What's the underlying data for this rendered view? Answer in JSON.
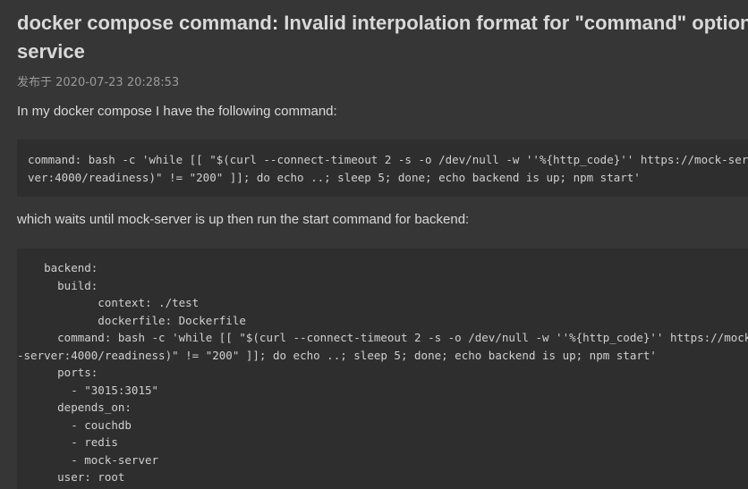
{
  "article": {
    "title": "docker compose command: Invalid interpolation format for \"command\" option in service",
    "published_label": "发布于 2020-07-23 20:28:53",
    "intro": "In my docker compose I have the following command:",
    "middle": "which waits until mock-server is up then run the start command for backend:"
  },
  "code_1": {
    "lines": [
      "command: bash -c 'while [[ \"$(curl --connect-timeout 2 -s -o /dev/null -w ''%{http_code}'' https://mock-ser",
      "ver:4000/readiness)\" != \"200\" ]]; do echo ..; sleep 5; done; echo backend is up; npm start'"
    ]
  },
  "code_2": {
    "lines": [
      "    backend:",
      "      build:",
      "            context: ./test",
      "            dockerfile: Dockerfile",
      "      command: bash -c 'while [[ \"$(curl --connect-timeout 2 -s -o /dev/null -w ''%{http_code}'' https://mock",
      "-server:4000/readiness)\" != \"200\" ]]; do echo ..; sleep 5; done; echo backend is up; npm start'",
      "      ports:",
      "        - \"3015:3015\"",
      "      depends_on:",
      "        - couchdb",
      "        - redis",
      "        - mock-server",
      "      user: root"
    ]
  }
}
